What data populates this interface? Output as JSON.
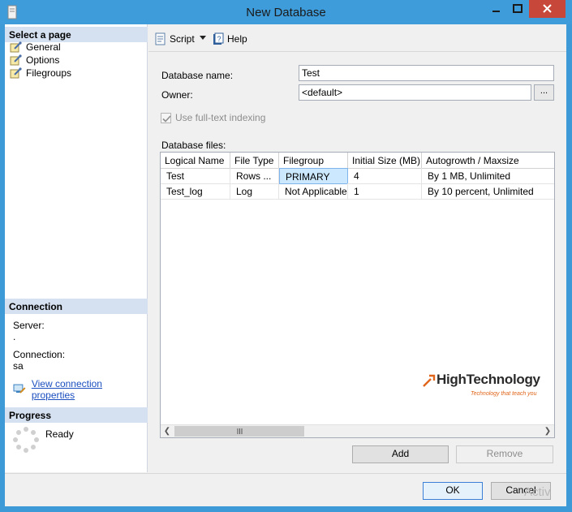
{
  "window": {
    "title": "New Database",
    "icons": {
      "app": "database-icon",
      "minimize": "minimize-icon",
      "maximize": "maximize-icon",
      "close": "close-icon"
    },
    "colors": {
      "titlebar": "#3f9cdb",
      "close": "#c7473a"
    }
  },
  "sidebar": {
    "select_page_header": "Select a page",
    "pages": [
      {
        "label": "General",
        "icon": "wrench-page-icon"
      },
      {
        "label": "Options",
        "icon": "wrench-page-icon"
      },
      {
        "label": "Filegroups",
        "icon": "wrench-page-icon"
      }
    ],
    "connection_header": "Connection",
    "server_label": "Server:",
    "server_value": ".",
    "connection_label": "Connection:",
    "connection_value": "sa",
    "view_connection_link": "View connection properties",
    "progress_header": "Progress",
    "progress_status": "Ready"
  },
  "toolbar": {
    "script_label": "Script",
    "help_label": "Help"
  },
  "form": {
    "database_name_label": "Database name:",
    "database_name_value": "Test",
    "owner_label": "Owner:",
    "owner_value": "<default>",
    "browse_label": "...",
    "fulltext_label": "Use full-text indexing",
    "database_files_label": "Database files:"
  },
  "grid": {
    "columns": [
      "Logical Name",
      "File Type",
      "Filegroup",
      "Initial Size (MB)",
      "Autogrowth / Maxsize"
    ],
    "rows": [
      [
        "Test",
        "Rows ...",
        "PRIMARY",
        "4",
        "By 1 MB, Unlimited"
      ],
      [
        "Test_log",
        "Log",
        "Not Applicable",
        "1",
        "By 10 percent, Unlimited"
      ]
    ],
    "scroll_grip": "|||"
  },
  "watermark": {
    "title": "HighTechnology",
    "tagline": "Technology that teach you"
  },
  "buttons": {
    "add": "Add",
    "remove": "Remove",
    "ok": "OK",
    "cancel": "Cancel"
  },
  "overlay_text": "Activ"
}
